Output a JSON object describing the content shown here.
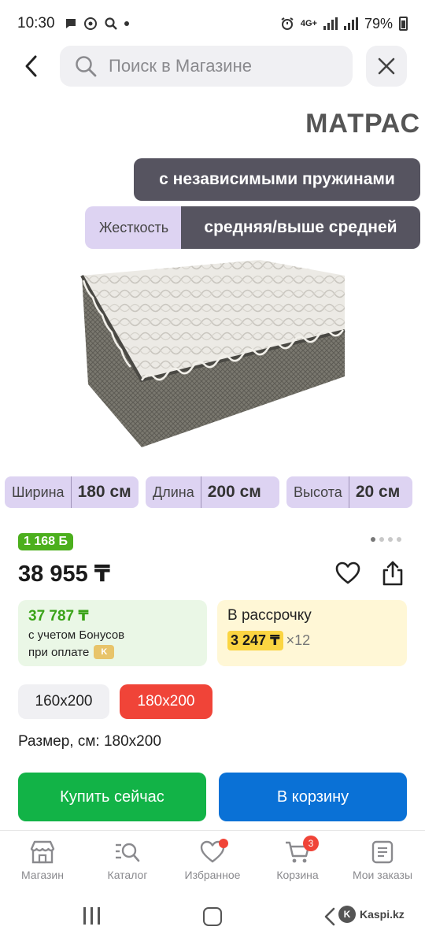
{
  "status_bar": {
    "time": "10:30",
    "network": "4G+",
    "battery": "79%"
  },
  "header": {
    "search_placeholder": "Поиск в Магазине"
  },
  "product_image": {
    "title": "МАТРАС",
    "spring_type": "с независимыми пружинами",
    "hardness_label": "Жесткость",
    "hardness_value": "средняя/выше средней",
    "dimensions": [
      {
        "label": "Ширина",
        "value": "180 см"
      },
      {
        "label": "Длина",
        "value": "200 см"
      },
      {
        "label": "Высота",
        "value": "20 см"
      }
    ]
  },
  "carousel": {
    "pages": 4,
    "active": 0
  },
  "pricing": {
    "bonus_badge": "1 168 Б",
    "price": "38 955 ₸",
    "bonus_price": "37 787 ₸",
    "bonus_line1": "с учетом Бонусов",
    "bonus_line2": "при оплате",
    "installment_title": "В рассрочку",
    "installment_monthly": "3 247 ₸",
    "installment_term": "×12"
  },
  "size_options": {
    "items": [
      "160x200",
      "180x200"
    ],
    "selected": "180x200",
    "label": "Размер, см: 180x200"
  },
  "actions": {
    "buy_now": "Купить сейчас",
    "add_to_cart": "В корзину"
  },
  "bottom_nav": {
    "items": [
      {
        "label": "Магазин",
        "icon": "store-icon"
      },
      {
        "label": "Каталог",
        "icon": "catalog-search-icon"
      },
      {
        "label": "Избранное",
        "icon": "heart-icon"
      },
      {
        "label": "Корзина",
        "icon": "cart-icon",
        "badge": "3"
      },
      {
        "label": "Мои заказы",
        "icon": "orders-icon"
      }
    ]
  },
  "system_nav": {
    "brand": "Kaspi.kz"
  },
  "colors": {
    "accent_red": "#f04438",
    "buy_green": "#12b347",
    "cart_blue": "#0a71d6",
    "bonus_green": "#4caf1d",
    "installment_yellow": "#fbd542",
    "pill_dark": "#565460",
    "pill_lilac": "#ddd3f2"
  }
}
